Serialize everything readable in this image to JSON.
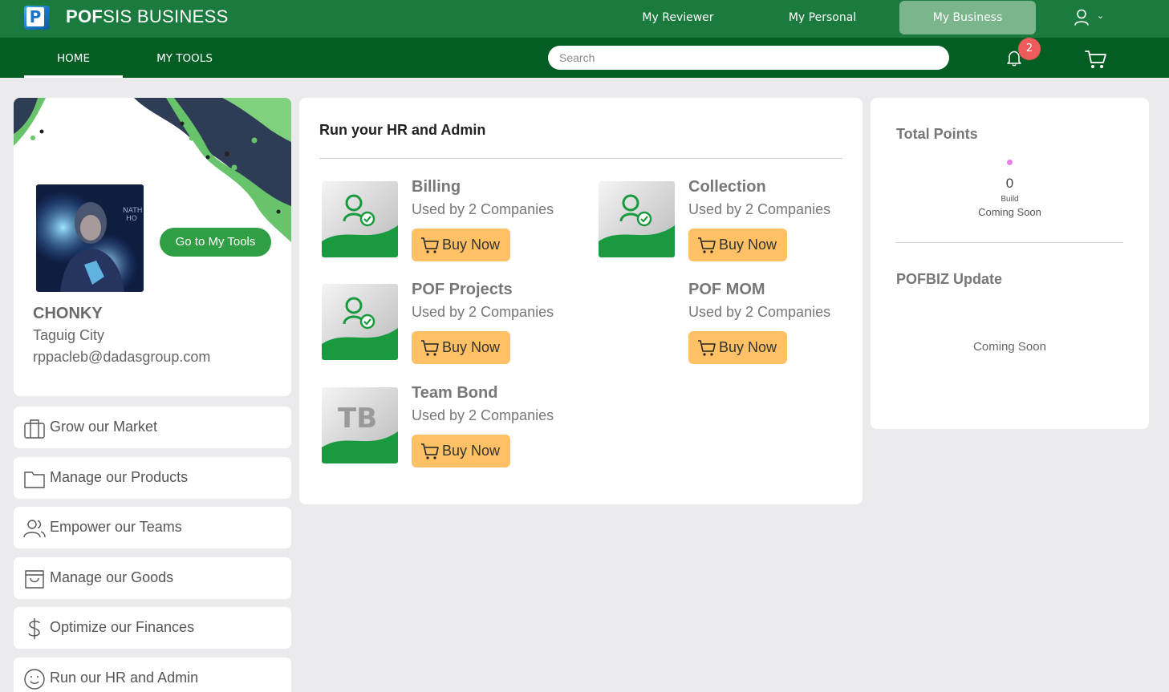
{
  "app": {
    "brand_bold": "POF",
    "brand_rest": "SIS BUSINESS"
  },
  "top_nav": {
    "reviewer": "My Reviewer",
    "personal": "My Personal",
    "business": "My Business"
  },
  "sub_nav": {
    "home": "HOME",
    "tools": "MY TOOLS"
  },
  "search": {
    "placeholder": "Search",
    "value": ""
  },
  "notifications": {
    "count": "2"
  },
  "profile": {
    "name": "CHONKY",
    "city": "Taguig City",
    "email": "rppacleb@dadasgroup.com",
    "go_tools": "Go to My Tools"
  },
  "menu": [
    {
      "label": "Grow our Market",
      "icon": "briefcase-icon"
    },
    {
      "label": "Manage our Products",
      "icon": "folder-icon"
    },
    {
      "label": "Empower our Teams",
      "icon": "users-icon"
    },
    {
      "label": "Manage our Goods",
      "icon": "shopping-bag-icon"
    },
    {
      "label": "Optimize our Finances",
      "icon": "dollar-icon"
    },
    {
      "label": "Run our HR and Admin",
      "icon": "smile-icon"
    }
  ],
  "main": {
    "title": "Run your HR and Admin",
    "tools": [
      {
        "name": "Billing",
        "used": "Used by 2 Companies",
        "buy": "Buy Now",
        "tile": "hr-person-icon"
      },
      {
        "name": "Collection",
        "used": "Used by 2 Companies",
        "buy": "Buy Now",
        "tile": "hr-person-icon"
      },
      {
        "name": "POF Projects",
        "used": "Used by 2 Companies",
        "buy": "Buy Now",
        "tile": "hr-person-icon"
      },
      {
        "name": "POF MOM",
        "used": "Used by 2 Companies",
        "buy": "Buy Now",
        "tile": ""
      },
      {
        "name": "Team Bond",
        "used": "Used by 2 Companies",
        "buy": "Buy Now",
        "tile": "team-bond-logo",
        "tile_text": "TB"
      }
    ]
  },
  "points": {
    "title": "Total Points",
    "value": "0",
    "build": "Build",
    "status": "Coming Soon"
  },
  "update": {
    "title": "POFBIZ Update",
    "status": "Coming Soon"
  },
  "colors": {
    "topbar": "#1b7a3d",
    "subbar": "#045e24",
    "active_tab": "#7ab58c",
    "buy_button": "#ffc163",
    "go_button": "#2f9e45",
    "badge": "#ef5b5b"
  }
}
